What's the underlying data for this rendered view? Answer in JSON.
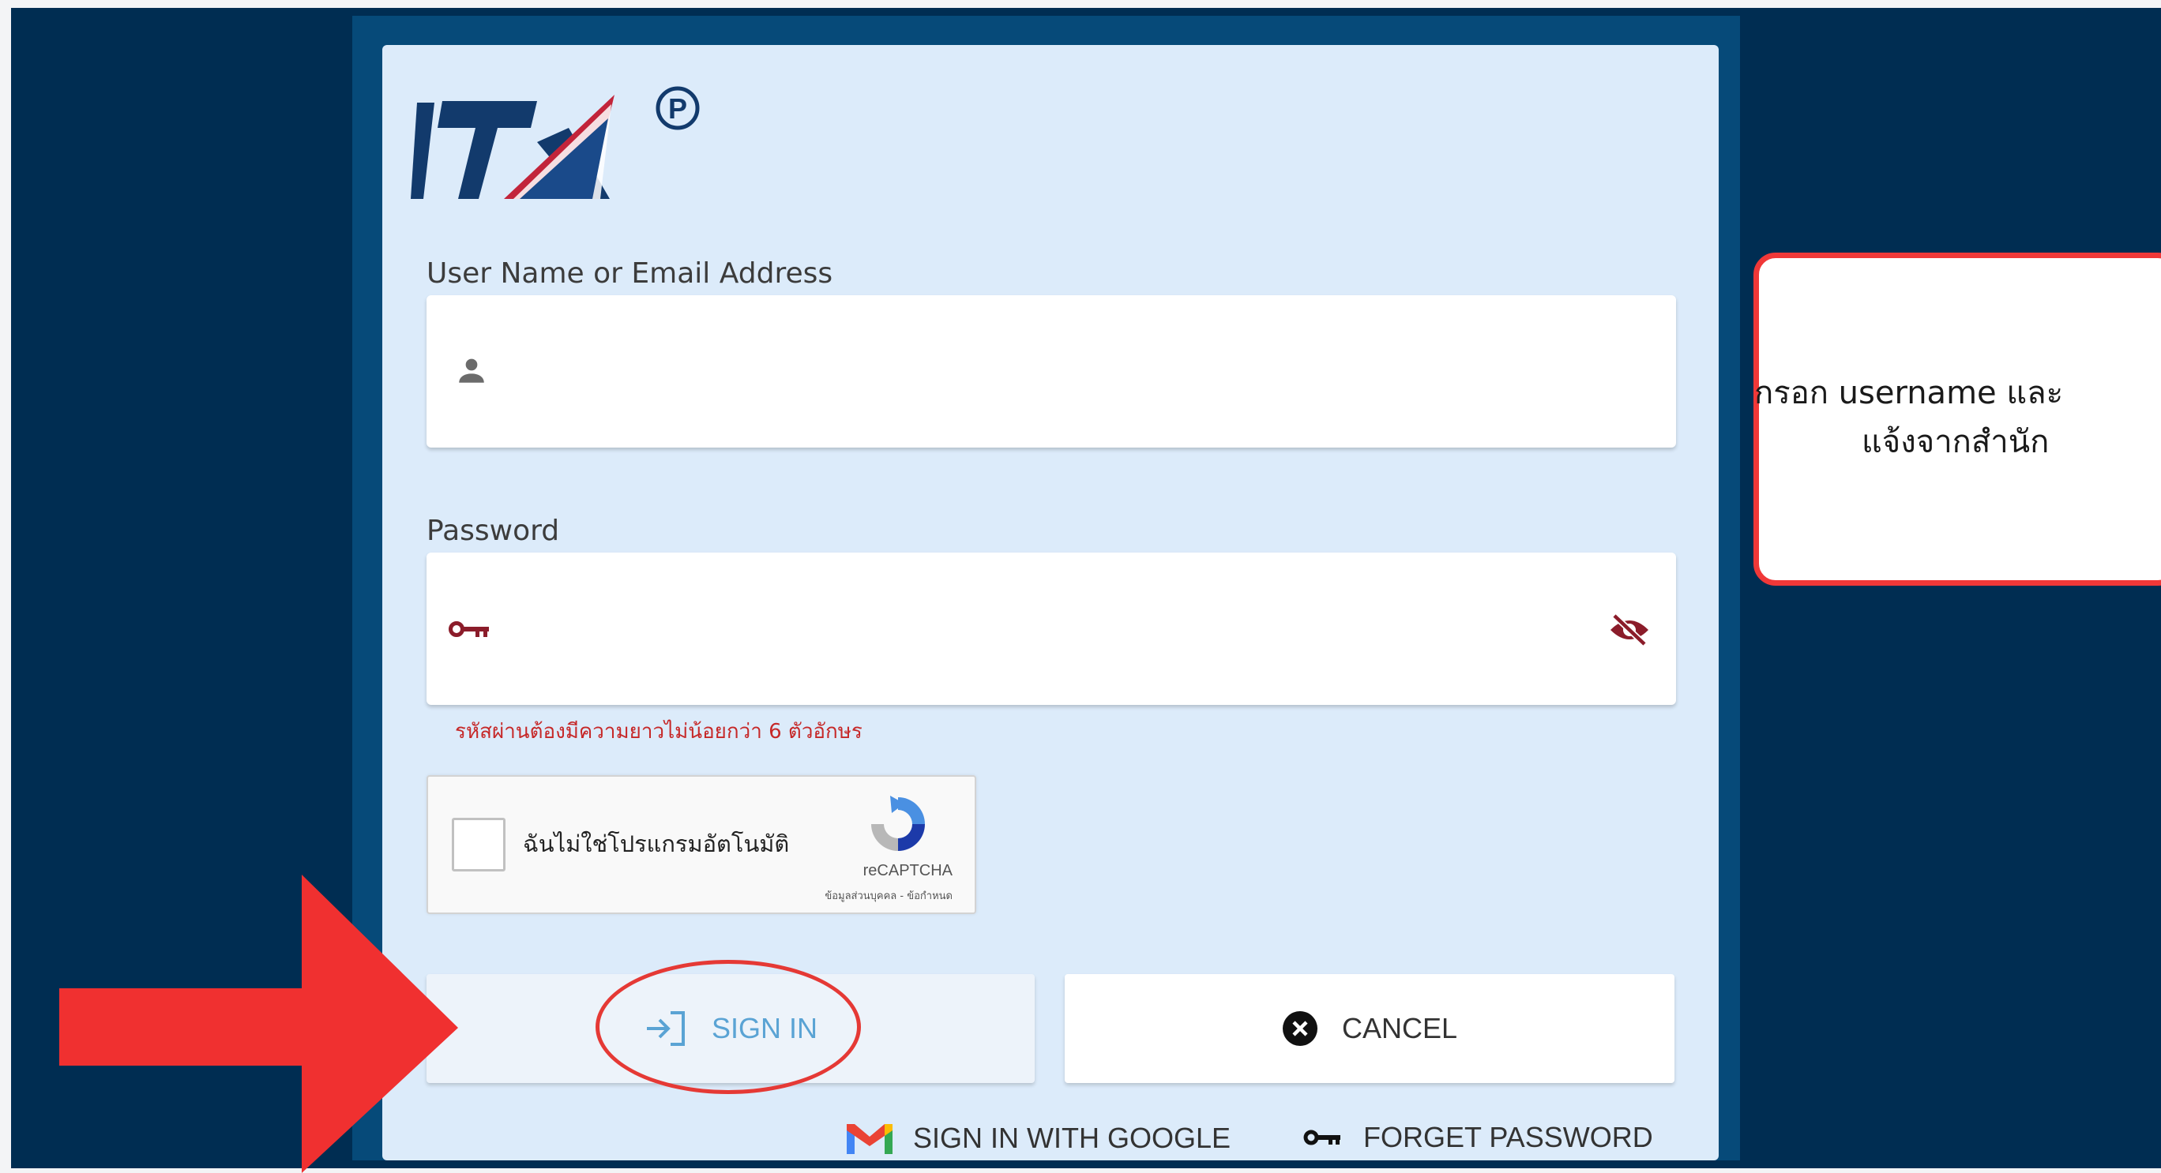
{
  "colors": {
    "background": "#002d52",
    "panel": "#064a79",
    "card": "#dcebfa",
    "accent_red": "#f03838",
    "signin_text": "#5aa3d4",
    "icon_dark_red": "#8b1c2a"
  },
  "logo": {
    "alt": "ITA",
    "registered_mark": "P"
  },
  "username": {
    "label": "User Name or Email Address",
    "value": "",
    "icon": "person-icon"
  },
  "password": {
    "label": "Password",
    "value": "",
    "icon": "key-icon",
    "toggle_icon": "eye-off-icon",
    "error": "รหัสผ่านต้องมีความยาวไม่น้อยกว่า 6 ตัวอักษร"
  },
  "captcha": {
    "label": "ฉันไม่ใช่โปรแกรมอัตโนมัติ",
    "brand": "reCAPTCHA",
    "links": "ข้อมูลส่วนบุคคล - ข้อกำหนด"
  },
  "buttons": {
    "signin": "SIGN IN",
    "cancel": "CANCEL"
  },
  "links": {
    "google": "SIGN IN WITH GOOGLE",
    "forget": "FORGET PASSWORD"
  },
  "callout": {
    "line1": "กรอก username และ",
    "line2": "แจ้งจากสำนัก"
  }
}
